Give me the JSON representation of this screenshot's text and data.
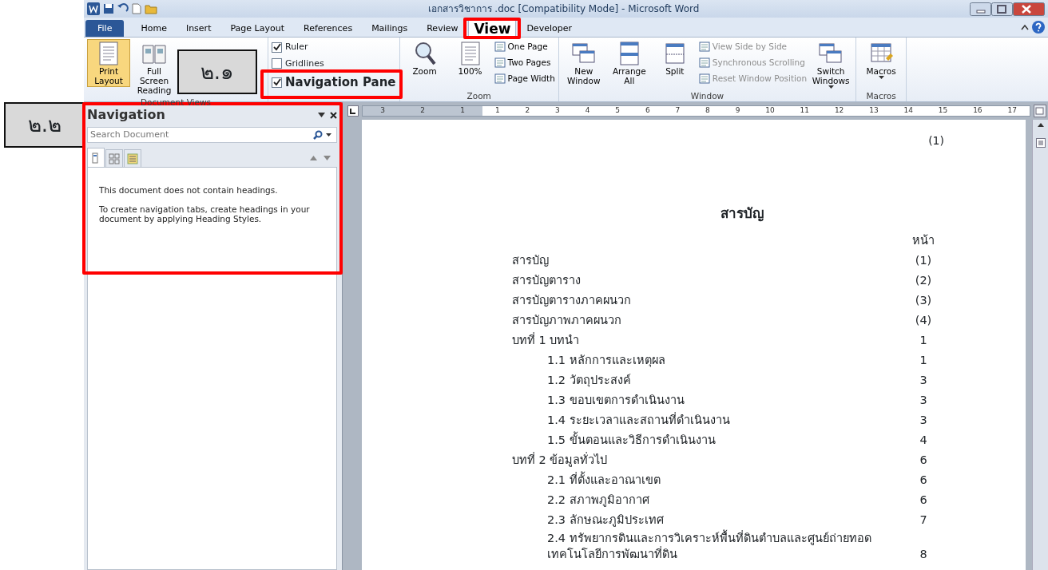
{
  "window": {
    "title": "เอกสารวิชาการ .doc [Compatibility Mode] - Microsoft Word"
  },
  "tabs": [
    {
      "label": "File",
      "kind": "file",
      "selected": false
    },
    {
      "label": "Home",
      "kind": "tab",
      "selected": false
    },
    {
      "label": "Insert",
      "kind": "tab",
      "selected": false
    },
    {
      "label": "Page Layout",
      "kind": "tab",
      "selected": false
    },
    {
      "label": "References",
      "kind": "tab",
      "selected": false
    },
    {
      "label": "Mailings",
      "kind": "tab",
      "selected": false
    },
    {
      "label": "Review",
      "kind": "tab",
      "selected": false
    },
    {
      "label": "View",
      "kind": "tab",
      "selected": true
    },
    {
      "label": "Developer",
      "kind": "tab",
      "selected": false
    }
  ],
  "ribbon": {
    "groups": [
      {
        "label": "Document Views",
        "items": [
          {
            "kind": "large",
            "label": "Print Layout",
            "selected": true
          },
          {
            "kind": "large",
            "label": "Full Screen Reading",
            "selected": false
          }
        ]
      },
      {
        "items": [
          {
            "kind": "check",
            "label": "Ruler",
            "checked": true,
            "emphasized": false
          },
          {
            "kind": "check",
            "label": "Gridlines",
            "checked": false,
            "emphasized": false
          },
          {
            "kind": "check",
            "label": "Navigation Pane",
            "checked": true,
            "emphasized": true
          }
        ]
      },
      {
        "label": "Zoom",
        "items": [
          {
            "kind": "large",
            "label": "Zoom",
            "selected": false
          },
          {
            "kind": "large",
            "label": "100%",
            "selected": false
          },
          {
            "kind": "stack",
            "items": [
              {
                "label": "One Page",
                "disabled": false
              },
              {
                "label": "Two Pages",
                "disabled": false
              },
              {
                "label": "Page Width",
                "disabled": false
              }
            ]
          }
        ]
      },
      {
        "label": "Window",
        "items": [
          {
            "kind": "large",
            "label": "New Window",
            "selected": false
          },
          {
            "kind": "large",
            "label": "Arrange All",
            "selected": false
          },
          {
            "kind": "large",
            "label": "Split",
            "selected": false
          },
          {
            "kind": "stack",
            "items": [
              {
                "label": "View Side by Side",
                "disabled": true
              },
              {
                "label": "Synchronous Scrolling",
                "disabled": true
              },
              {
                "label": "Reset Window Position",
                "disabled": true
              }
            ]
          },
          {
            "kind": "large",
            "label": "Switch Windows",
            "selected": false,
            "dropdown": true
          }
        ]
      },
      {
        "label": "Macros",
        "items": [
          {
            "kind": "large",
            "label": "Macros",
            "selected": false,
            "dropdown": true
          }
        ]
      }
    ]
  },
  "navigation": {
    "title": "Navigation",
    "search": {
      "placeholder": "Search Document"
    },
    "tabs": [
      {
        "selected": true
      },
      {
        "selected": false
      },
      {
        "selected": false
      }
    ],
    "messages": [
      "This document does not contain headings.",
      "To create navigation tabs, create headings in your document by applying Heading Styles."
    ]
  },
  "ruler": {
    "labels": [
      "3",
      "2",
      "1",
      "1",
      "2",
      "3",
      "4",
      "5",
      "6",
      "7",
      "8",
      "9",
      "10",
      "11",
      "12",
      "13",
      "14",
      "15",
      "16",
      "17"
    ]
  },
  "document": {
    "page_label": "(1)",
    "heading": "สารบัญ",
    "page_column": "หน้า",
    "entries": [
      {
        "text": "สารบัญ",
        "page": "(1)"
      },
      {
        "text": "สารบัญตาราง",
        "page": "(2)"
      },
      {
        "text": "สารบัญตารางภาคผนวก",
        "page": "(3)"
      },
      {
        "text": "สารบัญภาพภาคผนวก",
        "page": "(4)"
      },
      {
        "text": "บทที่ 1 บทนำ",
        "page": "1",
        "children": [
          {
            "text": "1.1 หลักการและเหตุผล",
            "page": "1"
          },
          {
            "text": "1.2 วัตถุประสงค์",
            "page": "3"
          },
          {
            "text": "1.3 ขอบเขตการดำเนินงาน",
            "page": "3"
          },
          {
            "text": "1.4 ระยะเวลาและสถานที่ดำเนินงาน",
            "page": "3"
          },
          {
            "text": "1.5 ขั้นตอนและวิธีการดำเนินงาน",
            "page": "4"
          }
        ]
      },
      {
        "text": "บทที่ 2 ข้อมูลทั่วไป",
        "page": "6",
        "children": [
          {
            "text": "2.1 ที่ตั้งและอาณาเขต",
            "page": "6"
          },
          {
            "text": "2.2 สภาพภูมิอากาศ",
            "page": "6"
          },
          {
            "text": "2.3 ลักษณะภูมิประเทศ",
            "page": "7"
          },
          {
            "text": "2.4 ทรัพยากรดินและการวิเคราะห์พื้นที่ดินตำบลและศูนย์ถ่ายทอดเทคโนโลยีการพัฒนาที่ดิน",
            "page": "8"
          }
        ]
      }
    ]
  },
  "annotations": [
    {
      "label": "๒.๑"
    },
    {
      "label": "๒.๒"
    }
  ]
}
